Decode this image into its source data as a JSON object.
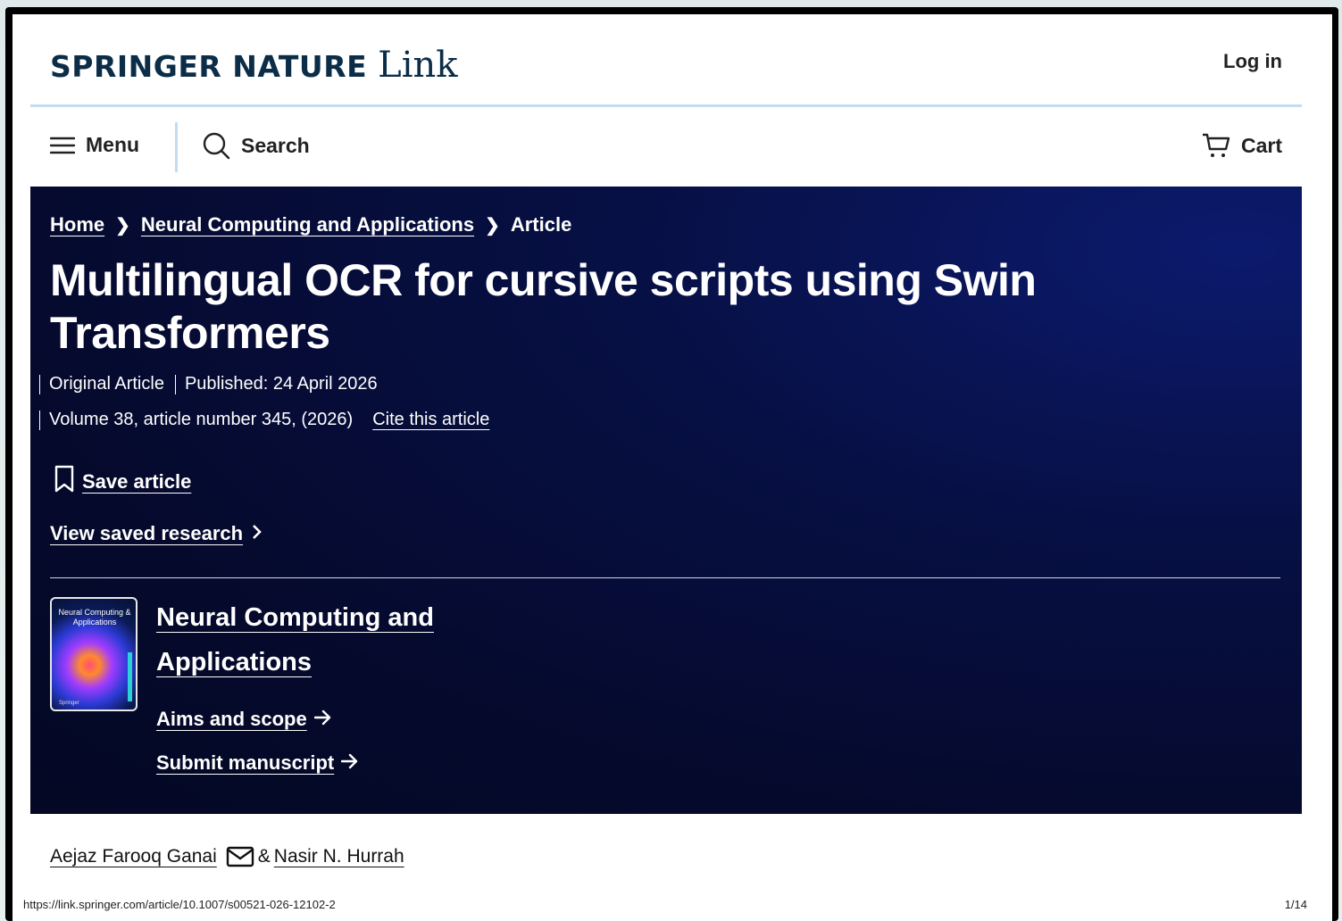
{
  "header": {
    "brand_main": "SPRINGER NATURE",
    "brand_link": "Link",
    "login_label": "Log in"
  },
  "nav": {
    "menu_label": "Menu",
    "search_label": "Search",
    "cart_label": "Cart"
  },
  "breadcrumb": {
    "items": [
      "Home",
      "Neural Computing and Applications",
      "Article"
    ]
  },
  "article": {
    "title": "Multilingual OCR for cursive scripts using Swin Transformers",
    "type": "Original Article",
    "published": "Published: 24 April 2026",
    "volume": "Volume 38, article number 345, (2026)",
    "cite_label": "Cite this article",
    "save_label": "Save article",
    "view_saved_label": "View saved research"
  },
  "journal": {
    "cover_title": "Neural Computing & Applications",
    "cover_publisher": "Springer",
    "name": "Neural Computing and Applications",
    "aims_label": "Aims and scope",
    "submit_label": "Submit manuscript"
  },
  "authors": {
    "first": "Aejaz Farooq Ganai",
    "separator": "&",
    "second": "Nasir N. Hurrah"
  },
  "footer": {
    "url": "https://link.springer.com/article/10.1007/s00521-026-12102-2",
    "page": "1/14"
  }
}
